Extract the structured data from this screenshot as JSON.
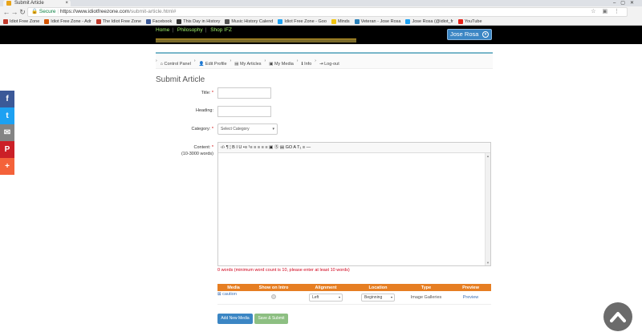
{
  "browser": {
    "tab_title": "Submit Article",
    "secure_label": "Secure",
    "url_host": "https://www.idiotfreezone.com",
    "url_path": "/submit-article.html#",
    "bookmarks": [
      {
        "label": "Idiot Free Zone",
        "color": "#c0392b"
      },
      {
        "label": "Idiot Free Zone - Adr",
        "color": "#d35400"
      },
      {
        "label": "The Idiot Free Zone",
        "color": "#c0392b"
      },
      {
        "label": "Facebook",
        "color": "#3b5998"
      },
      {
        "label": "This Day in History",
        "color": "#333333"
      },
      {
        "label": "Music History Calend",
        "color": "#555555"
      },
      {
        "label": "Idiot Free Zone - Goo",
        "color": "#1da1f2"
      },
      {
        "label": "Minds",
        "color": "#f1c40f"
      },
      {
        "label": "Veteran - Jose Rosa",
        "color": "#2980b9"
      },
      {
        "label": "Jose Rosa (@idiot_fr",
        "color": "#1da1f2"
      },
      {
        "label": "YouTube",
        "color": "#e62117"
      }
    ]
  },
  "header": {
    "links": [
      "Home",
      "Philosophy",
      "Shop IFZ"
    ],
    "user_name": "Jose Rosa"
  },
  "control_nav": [
    "Control Panel",
    "Edit Profile",
    "My Articles",
    "My Media",
    "Info",
    "Log-out"
  ],
  "page_title": "Submit Article",
  "form": {
    "title_label": "Title:",
    "heading_label": "Heading:",
    "category_label": "Category:",
    "category_placeholder": "Select Category",
    "content_label": "Content:",
    "content_hint": "(10-3000 words)",
    "toolbar_glyphs": "‹/›  ¶  ¦  B  I  U  •≡  ¹≡  ≡  ≡  ≡  ≡  ▣  Ⓢ  ▤  GO  A  T₁  ≡  —",
    "word_message": "0 words (minimum word count is 10, please enter at least 10 words)"
  },
  "media_table": {
    "headers": [
      "Media",
      "Show on Intro",
      "Alignment",
      "Location",
      "Type",
      "Preview"
    ],
    "row": {
      "media": "caution",
      "alignment": "Left",
      "location": "Beginning",
      "type": "Image Galleries",
      "preview": "Preview"
    }
  },
  "buttons": {
    "add_media": "Add New Media",
    "save": "Save & Submit"
  },
  "share": [
    "f",
    "t",
    "✉",
    "P",
    "+"
  ],
  "colors": {
    "orange": "#e67e22",
    "blue": "#3b86c4",
    "green_link": "#9ff06a"
  }
}
